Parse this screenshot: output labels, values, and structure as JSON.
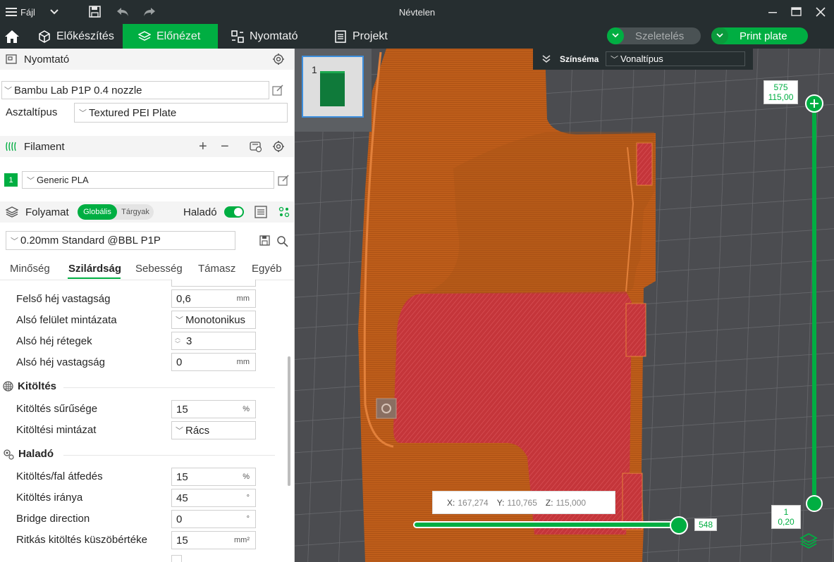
{
  "titlebar": {
    "file_label": "Fájl",
    "window_title": "Névtelen"
  },
  "tabs": [
    {
      "label": "Előkészítés"
    },
    {
      "label": "Előnézet"
    },
    {
      "label": "Nyomtató"
    },
    {
      "label": "Projekt"
    }
  ],
  "actions": {
    "slice_label": "Szeletelés",
    "print_label": "Print plate"
  },
  "printer": {
    "section_title": "Nyomtató",
    "printer_name": "Bambu Lab P1P 0.4 nozzle",
    "plate_type_label": "Asztaltípus",
    "plate_type_value": "Textured PEI Plate"
  },
  "filament": {
    "section_title": "Filament",
    "slot_number": "1",
    "filament_name": "Generic PLA"
  },
  "process": {
    "section_title": "Folyamat",
    "scope_global": "Globális",
    "scope_objects": "Tárgyak",
    "advanced_label": "Haladó",
    "advanced_on": true,
    "preset_name": "0.20mm Standard @BBL P1P",
    "subtabs": [
      "Minőség",
      "Szilárdság",
      "Sebesség",
      "Támasz",
      "Egyéb"
    ],
    "active_subtab": "Szilárdság"
  },
  "settings": {
    "top_shell_thickness": {
      "label": "Felső héj vastagság",
      "value": "0,6",
      "unit": "mm"
    },
    "bottom_surface_pattern": {
      "label": "Alsó felület mintázata",
      "value": "Monotonikus"
    },
    "bottom_shell_layers": {
      "label": "Alsó héj rétegek",
      "value": "3"
    },
    "bottom_shell_thickness": {
      "label": "Alsó héj vastagság",
      "value": "0",
      "unit": "mm"
    },
    "infill_group": "Kitöltés",
    "infill_density": {
      "label": "Kitöltés sűrűsége",
      "value": "15",
      "unit": "%"
    },
    "infill_pattern": {
      "label": "Kitöltési mintázat",
      "value": "Rács"
    },
    "advanced_group": "Haladó",
    "infill_wall_overlap": {
      "label": "Kitöltés/fal átfedés",
      "value": "15",
      "unit": "%"
    },
    "infill_direction": {
      "label": "Kitöltés iránya",
      "value": "45",
      "unit": "°"
    },
    "bridge_direction": {
      "label": "Bridge direction",
      "value": "0",
      "unit": "°"
    },
    "sparse_infill_threshold": {
      "label": "Ritkás kitöltés küszöbértéke",
      "value": "15",
      "unit": "mm²"
    }
  },
  "viewport": {
    "plate_number": "1",
    "color_scheme_label": "Színséma",
    "color_scheme_value": "Vonaltípus",
    "layer_top": "575",
    "height_top": "115,00",
    "layer_bottom": "1",
    "height_bottom": "0,20",
    "horizontal_value": "548",
    "coord_x_label": "X:",
    "coord_x": "167,274",
    "coord_y_label": "Y:",
    "coord_y": "110,765",
    "coord_z_label": "Z:",
    "coord_z": "115,000"
  },
  "colors": {
    "accent": "#00ae42",
    "titlebar": "#262e30",
    "viewport_bg": "#4b4c50",
    "model_orange": "#c4631b",
    "model_red": "#c8353a"
  }
}
